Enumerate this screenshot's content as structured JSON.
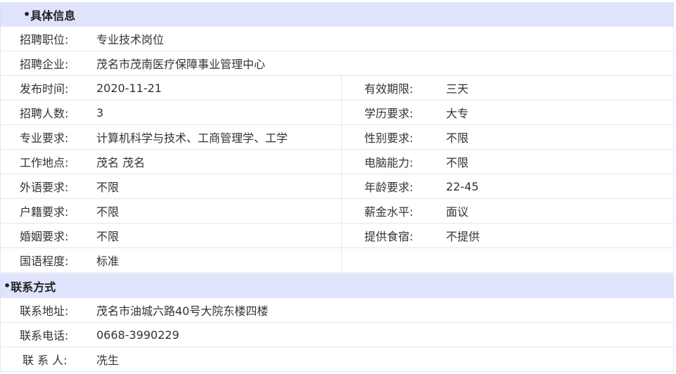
{
  "sections": {
    "details_title": "具体信息",
    "contact_title": "联系方式",
    "bullet": "•"
  },
  "details": {
    "position": {
      "label": "招聘职位:",
      "value": "专业技术岗位"
    },
    "company": {
      "label": "招聘企业:",
      "value": "茂名市茂南医疗保障事业管理中心"
    },
    "publish_time": {
      "label": "发布时间:",
      "value": "2020-11-21"
    },
    "valid_period": {
      "label": "有效期限:",
      "value": "三天"
    },
    "headcount": {
      "label": "招聘人数:",
      "value": "3"
    },
    "education": {
      "label": "学历要求:",
      "value": "大专"
    },
    "major": {
      "label": "专业要求:",
      "value": "计算机科学与技术、工商管理学、工学"
    },
    "gender": {
      "label": "性别要求:",
      "value": "不限"
    },
    "location": {
      "label": "工作地点:",
      "value": "茂名 茂名"
    },
    "computer_skill": {
      "label": "电脑能力:",
      "value": "不限"
    },
    "foreign_language": {
      "label": "外语要求:",
      "value": "不限"
    },
    "age": {
      "label": "年龄要求:",
      "value": "22-45"
    },
    "household": {
      "label": "户籍要求:",
      "value": "不限"
    },
    "salary": {
      "label": "薪金水平:",
      "value": "面议"
    },
    "marital": {
      "label": "婚姻要求:",
      "value": "不限"
    },
    "board": {
      "label": "提供食宿:",
      "value": "不提供"
    },
    "mandarin": {
      "label": "国语程度:",
      "value": "标准"
    }
  },
  "contact": {
    "address": {
      "label": "联系地址:",
      "value": "茂名市油城六路40号大院东楼四楼"
    },
    "phone": {
      "label": "联系电话:",
      "value": "0668-3990229"
    },
    "person": {
      "label": "联 系 人:",
      "value": "冼生"
    }
  },
  "colors": {
    "header_bg": "#dfe3fb",
    "border": "#dde7f3",
    "text": "#333333"
  }
}
